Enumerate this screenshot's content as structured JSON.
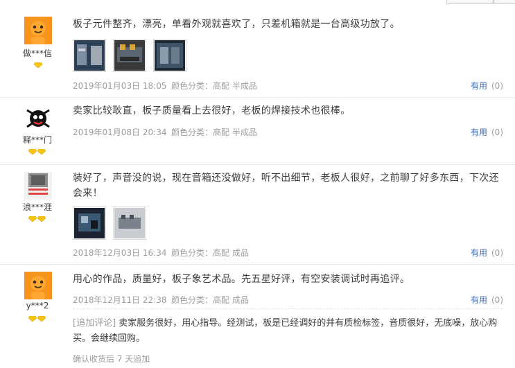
{
  "reviews": [
    {
      "user": "做***信",
      "content": "板子元件整齐，漂亮，单看外观就喜欢了，只差机箱就是一台高级功放了。",
      "date": "2019年01月03日 18:05",
      "spec": "颜色分类：高配 半成品",
      "useful_label": "有用",
      "useful_count": "(0)",
      "diamonds": 1
    },
    {
      "user": "释***门",
      "content": "卖家比较耿直，板子质量看上去很好，老板的焊接技术也很棒。",
      "date": "2019年01月08日 20:34",
      "spec": "颜色分类：高配 半成品",
      "useful_label": "有用",
      "useful_count": "(0)",
      "diamonds": 2
    },
    {
      "user": "浪***涯",
      "content": "装好了，声音没的说，现在音箱还没做好，听不出细节，老板人很好，之前聊了好多东西，下次还会来！",
      "date": "2018年12月03日 16:34",
      "spec": "颜色分类：高配 成品",
      "useful_label": "有用",
      "useful_count": "(0)",
      "diamonds": 2
    },
    {
      "user": "y***2",
      "content": "用心的作品，质量好，板子象艺术品。先五星好评，有空安装调试时再追评。",
      "date": "2018年12月11日 22:38",
      "spec": "颜色分类：高配 成品",
      "useful_label": "有用",
      "useful_count": "(0)",
      "diamonds": 2,
      "append": {
        "tag": "[追加评论]",
        "text": "卖家服务很好，用心指导。经测试，板是已经调好的并有质检标签，音质很好，无底噪，放心购买。会继续回购。",
        "meta": "确认收货后 7 天追加"
      }
    }
  ],
  "colors": {
    "link_blue": "#3d6bb3",
    "meta_gray": "#9c9c9c",
    "divider": "#e6e6e6",
    "avatar_orange": "#f7941d",
    "diamond_yellow": "#f5c518"
  }
}
